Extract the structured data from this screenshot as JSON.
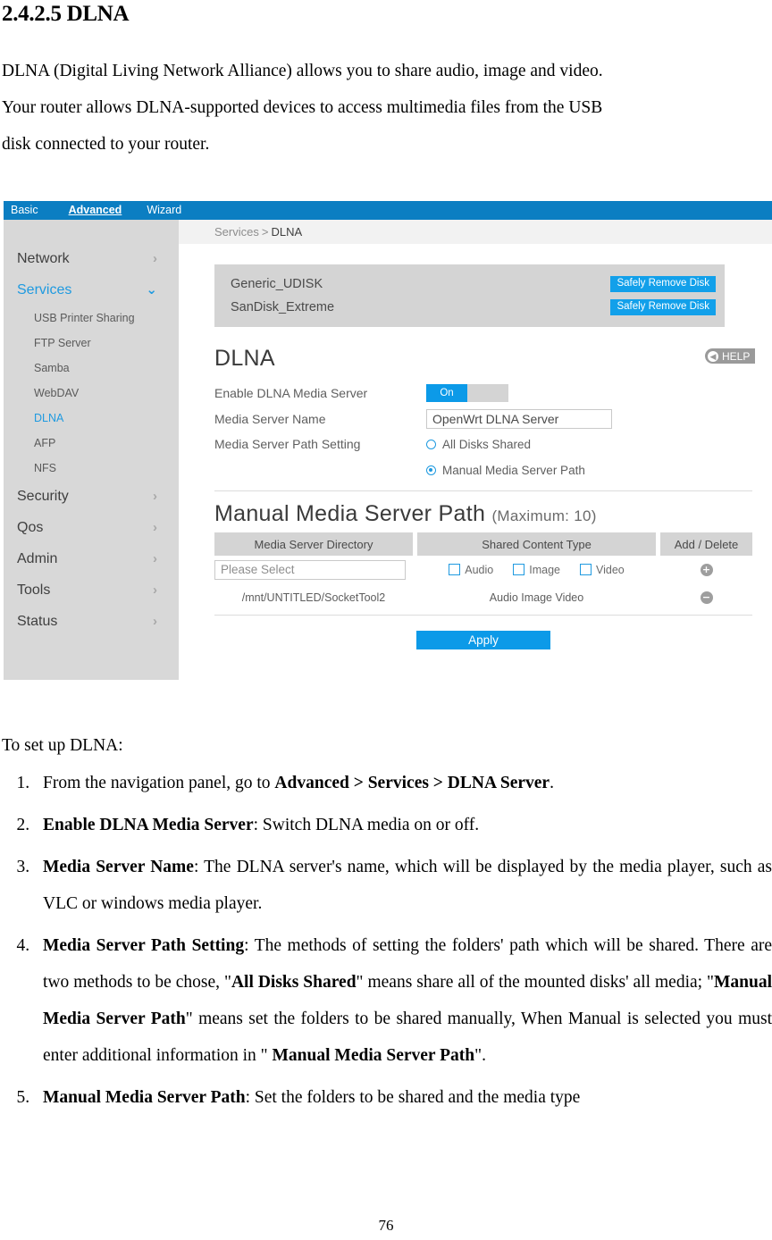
{
  "document": {
    "heading": "2.4.2.5 DLNA",
    "intro_lines": [
      "DLNA (Digital Living Network Alliance) allows you to share audio, image and video.",
      "Your router allows DLNA-supported devices to access multimedia files from the USB",
      "disk connected to your router."
    ],
    "lead": "To set up DLNA:",
    "page_number": "76",
    "steps": [
      {
        "parts": [
          {
            "t": "From the navigation panel, go to ",
            "b": false
          },
          {
            "t": "Advanced > Services > DLNA Server",
            "b": true
          },
          {
            "t": ".",
            "b": false
          }
        ]
      },
      {
        "parts": [
          {
            "t": "Enable DLNA Media Server",
            "b": true
          },
          {
            "t": ": Switch DLNA media on or off.",
            "b": false
          }
        ]
      },
      {
        "parts": [
          {
            "t": "Media Server Name",
            "b": true
          },
          {
            "t": ": The DLNA server's name, which will be displayed by the media player, such as VLC or windows media player.",
            "b": false
          }
        ]
      },
      {
        "parts": [
          {
            "t": "Media Server Path Setting",
            "b": true
          },
          {
            "t": ": The methods of setting the folders' path which will be shared. There are two methods to be chose, \"",
            "b": false
          },
          {
            "t": "All Disks Shared",
            "b": true
          },
          {
            "t": "\" means share all of the mounted disks' all media; \"",
            "b": false
          },
          {
            "t": "Manual Media Server Path",
            "b": true
          },
          {
            "t": "\" means set the folders to be shared manually, When Manual is selected you must enter additional information in \" ",
            "b": false
          },
          {
            "t": "Manual Media Server Path",
            "b": true
          },
          {
            "t": "\".",
            "b": false
          }
        ]
      },
      {
        "parts": [
          {
            "t": "Manual Media Server Path",
            "b": true
          },
          {
            "t": ": Set the folders to be shared and the media type",
            "b": false
          }
        ]
      }
    ]
  },
  "ui": {
    "colors": {
      "nav_blue": "#0b7ec2",
      "accent_blue": "#0c9ae8",
      "link_blue": "#1f9ae0",
      "panel_gray": "#d4d4d4",
      "sidebar_gray": "#d8d8d8"
    },
    "topnav": [
      {
        "label": "Basic",
        "active": false
      },
      {
        "label": "Advanced",
        "active": true
      },
      {
        "label": "Wizard",
        "active": false
      }
    ],
    "sidebar": [
      {
        "label": "Network",
        "type": "group",
        "chevron": "›",
        "active": false
      },
      {
        "label": "Services",
        "type": "group",
        "chevron": "⌄",
        "active": true
      },
      {
        "label": "USB Printer Sharing",
        "type": "sub",
        "active": false
      },
      {
        "label": "FTP Server",
        "type": "sub",
        "active": false
      },
      {
        "label": "Samba",
        "type": "sub",
        "active": false
      },
      {
        "label": "WebDAV",
        "type": "sub",
        "active": false
      },
      {
        "label": "DLNA",
        "type": "sub",
        "active": true
      },
      {
        "label": "AFP",
        "type": "sub",
        "active": false
      },
      {
        "label": "NFS",
        "type": "sub",
        "active": false
      },
      {
        "label": "Security",
        "type": "group",
        "chevron": "›",
        "active": false
      },
      {
        "label": "Qos",
        "type": "group",
        "chevron": "›",
        "active": false
      },
      {
        "label": "Admin",
        "type": "group",
        "chevron": "›",
        "active": false
      },
      {
        "label": "Tools",
        "type": "group",
        "chevron": "›",
        "active": false
      },
      {
        "label": "Status",
        "type": "group",
        "chevron": "›",
        "active": false
      }
    ],
    "breadcrumb": {
      "parent": "Services",
      "separator": ">",
      "current": "DLNA"
    },
    "help_tab": {
      "label": "HELP",
      "arrow": "◀"
    },
    "disks": [
      {
        "name": "Generic_UDISK",
        "button": "Safely Remove Disk"
      },
      {
        "name": "SanDisk_Extreme",
        "button": "Safely Remove Disk"
      }
    ],
    "dlna_section": {
      "title": "DLNA",
      "enable_label": "Enable DLNA Media Server",
      "enable_state": "On",
      "name_label": "Media Server Name",
      "name_value": "OpenWrt DLNA Server",
      "path_setting_label": "Media Server Path Setting",
      "options": [
        {
          "label": "All Disks Shared",
          "selected": false
        },
        {
          "label": "Manual Media Server Path",
          "selected": true
        }
      ]
    },
    "manual_section": {
      "title": "Manual Media Server Path",
      "subtitle": "(Maximum: 10)",
      "headers": [
        "Media Server Directory",
        "Shared Content Type",
        "Add / Delete"
      ],
      "new_row": {
        "directory_placeholder": "Please Select",
        "types": [
          {
            "label": "Audio",
            "checked": false
          },
          {
            "label": "Image",
            "checked": false
          },
          {
            "label": "Video",
            "checked": false
          }
        ],
        "action": "+"
      },
      "existing_rows": [
        {
          "directory": "/mnt/UNTITLED/SocketTool2",
          "types": "Audio Image Video",
          "action": "−"
        }
      ],
      "apply_label": "Apply"
    }
  }
}
